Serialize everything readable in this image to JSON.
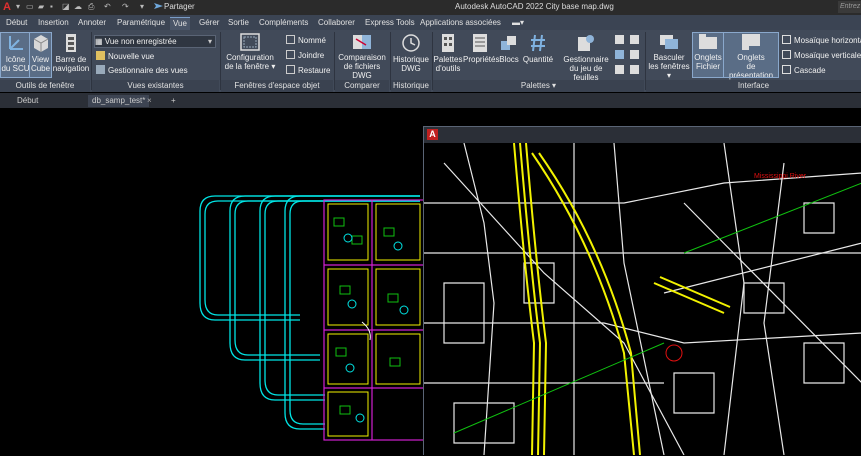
{
  "titlebar": {
    "app_letter": "A",
    "share_label": "Partager",
    "title": "Autodesk AutoCAD 2022",
    "filename": "City base map.dwg",
    "search_placeholder": "Entrez"
  },
  "ribbon_tabs": [
    "Début",
    "Insertion",
    "Annoter",
    "Paramétrique",
    "Vue",
    "Gérer",
    "Sortie",
    "Compléments",
    "Collaborer",
    "Express Tools",
    "Applications associées"
  ],
  "active_tab": "Vue",
  "panels": {
    "fenetre_tools": {
      "label": "Outils de fenêtre",
      "scu_line1": "Icône",
      "scu_line2": "du SCU",
      "viewcube_line1": "View",
      "viewcube_line2": "Cube",
      "nav_line1": "Barre de",
      "nav_line2": "navigation"
    },
    "vues": {
      "label": "Vues existantes",
      "dropdown_value": "Vue non enregistrée",
      "new_view": "Nouvelle vue",
      "view_manager": "Gestionnaire des vues"
    },
    "fenetres_objet": {
      "label": "Fenêtres d'espace objet",
      "config_line1": "Configuration",
      "config_line2": "de la fenêtre",
      "named": "Nommé",
      "join": "Joindre",
      "restore": "Restaure"
    },
    "comparer": {
      "label": "Comparer",
      "compare_line1": "Comparaison",
      "compare_line2": "de fichiers DWG"
    },
    "historique": {
      "label": "Historique",
      "hist_line1": "Historique",
      "hist_line2": "DWG"
    },
    "palettes": {
      "label": "Palettes",
      "tools_line1": "Palettes",
      "tools_line2": "d'outils",
      "props": "Propriétés",
      "blocks": "Blocs",
      "qty": "Quantité",
      "sheetset_line1": "Gestionnaire",
      "sheetset_line2": "du jeu de feuilles"
    },
    "interface": {
      "label": "Interface",
      "switch_line1": "Basculer",
      "switch_line2": "les fenêtres",
      "filetabs_line1": "Onglets",
      "filetabs_line2": "Fichier",
      "layouttabs_line1": "Onglets",
      "layouttabs_line2": "de présentation",
      "tile_h": "Mosaïque horizontale",
      "tile_v": "Mosaïque verticale",
      "cascade": "Cascade"
    }
  },
  "doc_tabs": [
    "Début",
    "db_samp_test*"
  ],
  "colors": {
    "cyan": "#00e5e5",
    "magenta": "#d020d0",
    "yellow": "#f2f200",
    "green": "#10c010",
    "red": "#e01010"
  },
  "map_labels": {
    "label1": "Mississippi River"
  }
}
